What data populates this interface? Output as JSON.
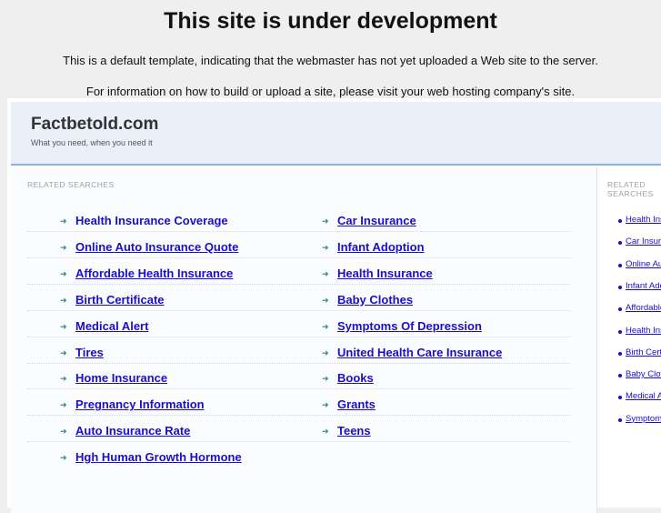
{
  "notice": {
    "title": "This site is under development",
    "line1": "This is a default template, indicating that the webmaster has not yet uploaded a Web site to the server.",
    "line2": "For information on how to build or upload a site, please visit your web hosting company's site."
  },
  "site": {
    "name": "Factbetold.com",
    "tagline": "What you need, when you need it"
  },
  "main": {
    "heading": "RELATED SEARCHES",
    "left": [
      "Health Insurance Coverage",
      "Online Auto Insurance Quote",
      "Affordable Health Insurance",
      "Birth Certificate",
      "Medical Alert",
      "Tires",
      "Home Insurance",
      "Pregnancy Information",
      "Auto Insurance Rate",
      "Hgh Human Growth Hormone"
    ],
    "right": [
      "Car Insurance",
      "Infant Adoption",
      "Health Insurance",
      "Baby Clothes",
      "Symptoms Of Depression",
      "United Health Care Insurance",
      "Books",
      "Grants",
      "Teens"
    ]
  },
  "side": {
    "heading": "RELATED SEARCHES",
    "items": [
      "Health Insurance Coverage",
      "Car Insurance",
      "Online Auto Insurance Quote",
      "Infant Adoption",
      "Affordable Health Insurance",
      "Health Insurance",
      "Birth Certificate",
      "Baby Clothes",
      "Medical Alert",
      "Symptoms Of Depression"
    ]
  }
}
